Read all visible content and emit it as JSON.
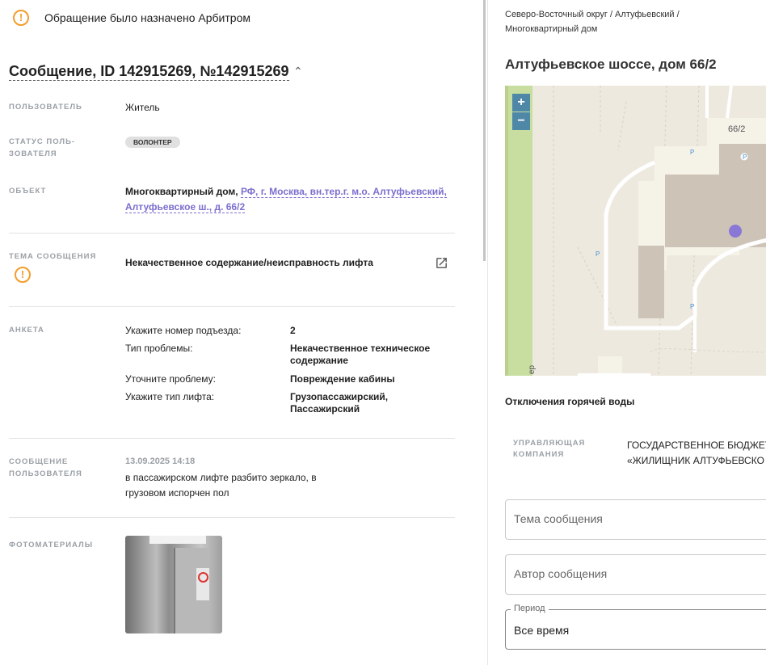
{
  "banner": {
    "text": "Обращение было назначено Арбитром",
    "icon": "warning-icon"
  },
  "message": {
    "title": "Сообщение, ID 142915269, №142915269"
  },
  "fields": {
    "user_label": "ПОЛЬЗОВАТЕЛЬ",
    "user_value": "Житель",
    "status_label_1": "СТАТУС ПОЛЬ-",
    "status_label_2": "ЗОВАТЕЛЯ",
    "status_chip": "ВОЛОНТЕР",
    "object_label": "ОБЪЕКТ",
    "object_prefix": "Многоквартирный дом,",
    "object_link_1": "РФ, г. Москва, вн.тер.г. м.о. Алтуфьевский,",
    "object_link_2": "Алтуфьевское ш., д. 66/2",
    "topic_label": "ТЕМА СООБЩЕНИЯ",
    "topic_value": "Некачественное содержание/неисправность лифта",
    "survey_label": "АНКЕТА",
    "survey": [
      {
        "q": "Укажите номер подъезда:",
        "a": "2"
      },
      {
        "q": "Тип проблемы:",
        "a": "Некачественное техническое содержание"
      },
      {
        "q": "Уточните проблему:",
        "a": "Повреждение кабины"
      },
      {
        "q": "Укажите тип лифта:",
        "a": "Грузопассажирский, Пассажирский"
      }
    ],
    "user_msg_label_1": "СООБЩЕНИЕ",
    "user_msg_label_2": "ПОЛЬЗОВАТЕЛЯ",
    "user_msg_date": "13.09.2025 14:18",
    "user_msg_text": "в пассажирском лифте разбито зеркало, в грузовом испорчен пол",
    "photos_label": "ФОТОМАТЕРИАЛЫ"
  },
  "right": {
    "breadcrumb_1": "Северо-Восточный округ / Алтуфьевский /",
    "breadcrumb_2": "Многоквартирный дом",
    "address": "Алтуфьевское шоссе, дом 66/2",
    "map": {
      "zoom_in": "+",
      "zoom_out": "−",
      "building_label": "66/2",
      "parking": "P",
      "street_fragment": "ер"
    },
    "hot_water": "Отключения горячей воды",
    "mgmt_label_1": "УПРАВЛЯЮЩАЯ",
    "mgmt_label_2": "КОМПАНИЯ",
    "mgmt_value_1": "ГОСУДАРСТВЕННОЕ БЮДЖЕТ",
    "mgmt_value_2": "«ЖИЛИЩНИК АЛТУФЬЕВСКО",
    "topic_placeholder": "Тема сообщения",
    "author_placeholder": "Автор сообщения",
    "period_label": "Период",
    "period_value": "Все время"
  },
  "colors": {
    "accent": "#7b6fcf",
    "warning": "#f59d2a",
    "map_button": "#4f88a7",
    "map_marker": "#8a78d6"
  }
}
